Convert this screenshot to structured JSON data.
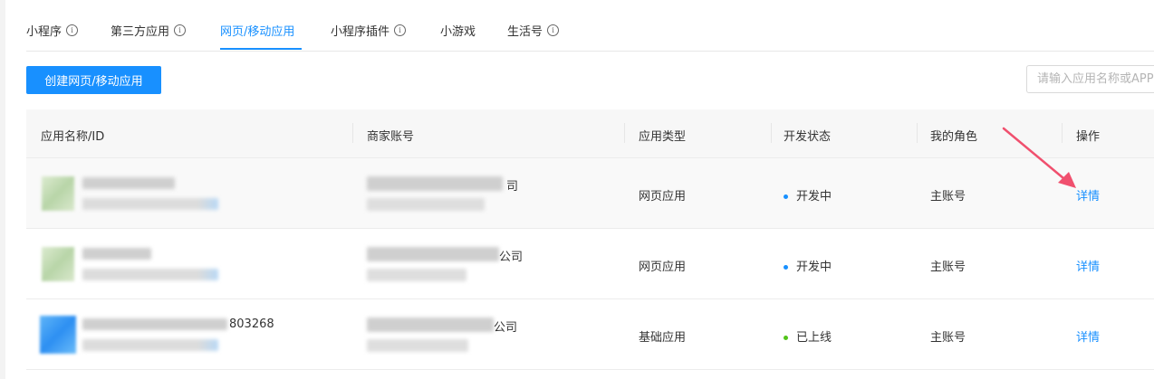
{
  "tabs": [
    {
      "label": "小程序",
      "info": true,
      "active": false
    },
    {
      "label": "第三方应用",
      "info": true,
      "active": false
    },
    {
      "label": "网页/移动应用",
      "info": false,
      "active": true
    },
    {
      "label": "小程序插件",
      "info": true,
      "active": false
    },
    {
      "label": "小游戏",
      "info": false,
      "active": false
    },
    {
      "label": "生活号",
      "info": true,
      "active": false
    }
  ],
  "toolbar": {
    "create_label": "创建网页/移动应用",
    "search_placeholder": "请输入应用名称或APPID"
  },
  "table": {
    "headers": [
      "应用名称/ID",
      "商家账号",
      "应用类型",
      "开发状态",
      "我的角色",
      "操作"
    ],
    "rows": [
      {
        "name_suffix": "",
        "merchant_suffix": "司",
        "type": "网页应用",
        "status": "开发中",
        "status_color": "#1890ff",
        "role": "主账号",
        "action": "详情"
      },
      {
        "name_suffix": "",
        "merchant_suffix": "公司",
        "type": "网页应用",
        "status": "开发中",
        "status_color": "#1890ff",
        "role": "主账号",
        "action": "详情"
      },
      {
        "name_suffix": "803268",
        "merchant_suffix": "公司",
        "type": "基础应用",
        "status": "已上线",
        "status_color": "#52c41a",
        "role": "主账号",
        "action": "详情"
      }
    ]
  },
  "colors": {
    "accent": "#1890ff",
    "online": "#52c41a",
    "annotation_arrow": "#f0506e"
  }
}
